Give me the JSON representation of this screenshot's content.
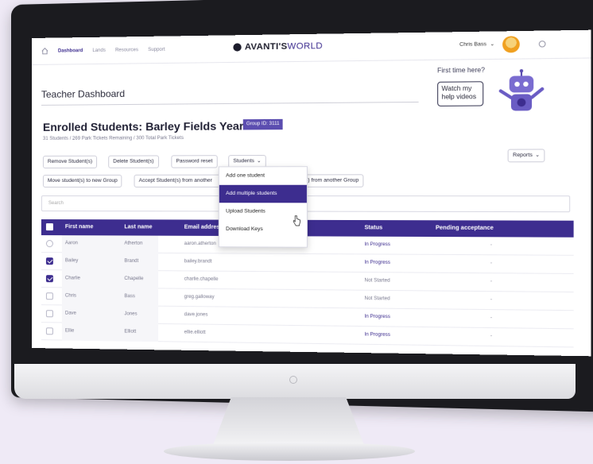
{
  "nav": {
    "links": [
      "Dashboard",
      "Lands",
      "Resources",
      "Support"
    ],
    "logo_main": "AVANTI'S",
    "logo_accent": "WORLD",
    "user_name": "Chris Bass"
  },
  "header": {
    "page_title": "Teacher Dashboard",
    "help_prompt": "First time here?",
    "help_button": "Watch my help videos"
  },
  "enrolled": {
    "title": "Enrolled Students: Barley Fields Year Five",
    "group_badge": "Group ID: 3111",
    "subline": "31 Students / 269 Park Tickets Remaining / 300 Total Park Tickets"
  },
  "toolbar": {
    "remove": "Remove Student(s)",
    "delete": "Delete Student(s)",
    "password": "Password reset",
    "students": "Students",
    "reports": "Reports",
    "move": "Move student(s) to new Group",
    "accept": "Accept Student(s) from another",
    "accept_tail": "(s) from another Group"
  },
  "dropdown": {
    "items": [
      "Add one student",
      "Add multiple students",
      "Upload Students",
      "Download Keys"
    ]
  },
  "search": {
    "placeholder": "Search"
  },
  "table": {
    "headers": [
      "First name",
      "Last name",
      "Email address/U",
      "Status",
      "Pending acceptance"
    ],
    "rows": [
      {
        "first": "Aaron",
        "last": "Atherton",
        "email": "aaron.atherton",
        "status": "In Progress",
        "pending": "-",
        "checked": false
      },
      {
        "first": "Bailey",
        "last": "Brandt",
        "email": "bailey.brandt",
        "status": "In Progress",
        "pending": "-",
        "checked": true
      },
      {
        "first": "Charlie",
        "last": "Chapelle",
        "email": "charlie.chapelle",
        "status": "Not Started",
        "pending": "-",
        "checked": true
      },
      {
        "first": "Chris",
        "last": "Bass",
        "email": "greg.galloway",
        "status": "Not Started",
        "pending": "-",
        "checked": false
      },
      {
        "first": "Dave",
        "last": "Jones",
        "email": "dave.jones",
        "status": "In Progress",
        "pending": "-",
        "checked": false
      },
      {
        "first": "Ellie",
        "last": "Elliott",
        "email": "ellie.elliott",
        "status": "In Progress",
        "pending": "-",
        "checked": false
      }
    ]
  },
  "colors": {
    "accent": "#3d2d8f",
    "badge": "#5b4db0",
    "background": "#efeaf6"
  }
}
